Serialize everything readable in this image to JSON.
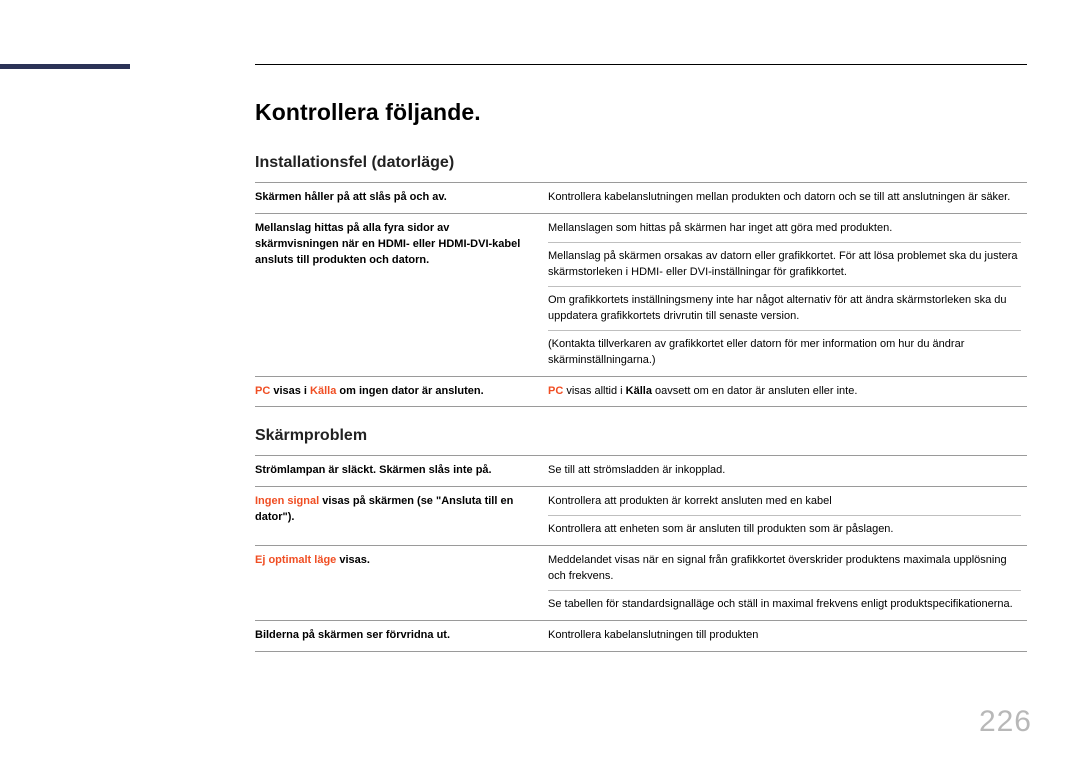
{
  "pageNumber": "226",
  "title": "Kontrollera följande.",
  "section1": {
    "heading": "Installationsfel (datorläge)",
    "row1": {
      "left": "Skärmen håller på att slås på och av.",
      "right": "Kontrollera kabelanslutningen mellan produkten och datorn och se till att anslutningen är säker."
    },
    "row2": {
      "left": "Mellanslag hittas på alla fyra sidor av skärmvisningen när en HDMI- eller HDMI-DVI-kabel ansluts till produkten och datorn.",
      "rightA": "Mellanslagen som hittas på skärmen har inget att göra med produkten.",
      "rightB": "Mellanslag på skärmen orsakas av datorn eller grafikkortet. För att lösa problemet ska du justera skärmstorleken i HDMI- eller DVI-inställningar för grafikkortet.",
      "rightC": "Om grafikkortets inställningsmeny inte har något alternativ för att ändra skärmstorleken ska du uppdatera grafikkortets drivrutin till senaste version.",
      "rightD": "(Kontakta tillverkaren av grafikkortet eller datorn för mer information om hur du ändrar skärminställningarna.)"
    },
    "row3": {
      "left_pc": "PC",
      "left_mid": " visas i ",
      "left_kalla": "Källa",
      "left_end": " om ingen dator är ansluten.",
      "right_pc": "PC",
      "right_mid": " visas alltid i ",
      "right_kalla": "Källa",
      "right_end": " oavsett om en dator är ansluten eller inte."
    }
  },
  "section2": {
    "heading": "Skärmproblem",
    "row1": {
      "left": "Strömlampan är släckt. Skärmen slås inte på.",
      "right": "Se till att strömsladden är inkopplad."
    },
    "row2": {
      "left_a": "Ingen signal",
      "left_b": " visas på skärmen (se \"Ansluta till en dator\").",
      "rightA": "Kontrollera att produkten är korrekt ansluten med en kabel",
      "rightB": "Kontrollera att enheten som är ansluten till produkten som är påslagen."
    },
    "row3": {
      "left_a": "Ej optimalt läge",
      "left_b": " visas.",
      "rightA": "Meddelandet visas när en signal från grafikkortet överskrider produktens maximala upplösning och frekvens.",
      "rightB": "Se tabellen för standardsignalläge och ställ in maximal frekvens enligt produktspecifikationerna."
    },
    "row4": {
      "left": "Bilderna på skärmen ser förvridna ut.",
      "right": "Kontrollera kabelanslutningen till produkten"
    }
  }
}
